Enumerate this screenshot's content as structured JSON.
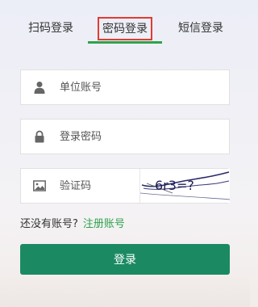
{
  "tabs": {
    "scan_label": "扫码登录",
    "password_label": "密码登录",
    "sms_label": "短信登录"
  },
  "form": {
    "account_placeholder": "单位账号",
    "password_placeholder": "登录密码",
    "captcha_placeholder": "验证码",
    "captcha_text": "6r3=?"
  },
  "register": {
    "prompt": "还没有账号?",
    "link_label": "注册账号"
  },
  "login_button_label": "登录",
  "colors": {
    "accent_green": "#2fa24d",
    "button_green": "#1b8a63",
    "highlight_red": "#e23b34"
  }
}
